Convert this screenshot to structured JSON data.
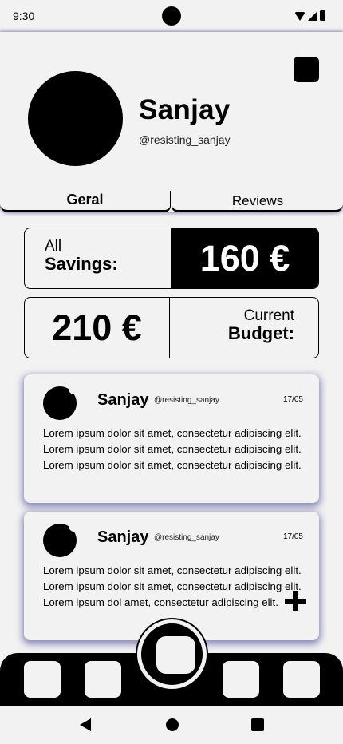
{
  "status_bar": {
    "time": "9:30"
  },
  "profile": {
    "name": "Sanjay",
    "handle": "@resisting_sanjay"
  },
  "tabs": [
    {
      "label": "Geral",
      "active": true
    },
    {
      "label": "Reviews",
      "active": false
    }
  ],
  "stats": {
    "savings": {
      "label_line1": "All",
      "label_line2": "Savings:",
      "value": "160 €"
    },
    "budget": {
      "label_line1": "Current",
      "label_line2": "Budget:",
      "value": "210 €"
    }
  },
  "reviews": [
    {
      "name": "Sanjay",
      "handle": "@resisting_sanjay",
      "date": "17/05",
      "text": "Lorem ipsum dolor sit amet, consectetur adipiscing elit. Lorem ipsum dolor sit amet, consectetur adipiscing elit. Lorem ipsum dolor sit amet, consectetur adipiscing elit."
    },
    {
      "name": "Sanjay",
      "handle": "@resisting_sanjay",
      "date": "17/05",
      "text": "Lorem ipsum dolor sit amet, consectetur adipiscing elit. Lorem ipsum dolor sit amet, consectetur adipiscing elit. Lorem ipsum dol amet, consectetur adipiscing elit."
    }
  ],
  "icons": {
    "settings": "settings-icon",
    "add": "plus-icon",
    "wifi": "wifi-icon",
    "signal": "signal-icon",
    "battery": "battery-icon"
  },
  "colors": {
    "background": "#f2f2f2",
    "primary": "#000000",
    "shadow": "#3c3c8c"
  }
}
